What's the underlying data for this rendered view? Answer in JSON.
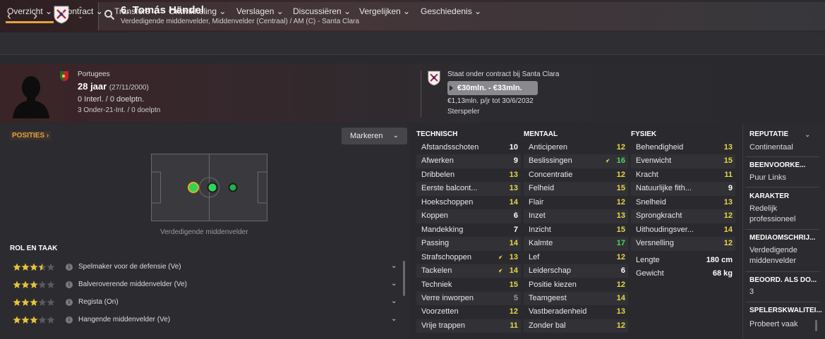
{
  "header": {
    "player_name": "6. Tomás Händel",
    "subtitle": "Verdedigende middenvelder, Middenvelder (Centraal) / AM (C) - Santa Clara"
  },
  "tabs": [
    {
      "label": "Overzicht"
    },
    {
      "label": "Contract"
    },
    {
      "label": "Transfers"
    },
    {
      "label": "Ontwikkeling"
    },
    {
      "label": "Verslagen"
    },
    {
      "label": "Discussiëren"
    },
    {
      "label": "Vergelijken"
    },
    {
      "label": "Geschiedenis"
    }
  ],
  "profile": {
    "nationality": "Portugees",
    "age": "28 jaar",
    "birthdate": "(27/11/2000)",
    "internationals": "0 Interl. / 0 doelptn.",
    "u21": "3 Onder-21-Int. / 0 doelptn",
    "contract": "Staat onder contract bij Santa Clara",
    "value": "€30mln. - €33mln.",
    "wage": "€1,13mln. p/jr tot 30/6/2032",
    "status": "Sterspeler"
  },
  "positions": {
    "title": "POSITIES",
    "highlight_button": "Markeren",
    "pitch_label": "Verdedigende middenvelder"
  },
  "roles": {
    "title": "ROL EN TAAK",
    "items": [
      {
        "label": "Spelmaker voor de defensie (Ve)",
        "stars": 3.5
      },
      {
        "label": "Balveroverende middenvelder (Ve)",
        "stars": 3
      },
      {
        "label": "Regista (On)",
        "stars": 3
      },
      {
        "label": "Hangende middenvelder (Ve)",
        "stars": 3
      }
    ]
  },
  "attributes": {
    "technical_title": "TECHNISCH",
    "mental_title": "MENTAAL",
    "physical_title": "FYSIEK",
    "technical": [
      {
        "name": "Afstandsschoten",
        "value": "10",
        "color": "white"
      },
      {
        "name": "Afwerken",
        "value": "9",
        "color": "white"
      },
      {
        "name": "Dribbelen",
        "value": "13",
        "color": "yellow"
      },
      {
        "name": "Eerste balcont...",
        "value": "13",
        "color": "yellow"
      },
      {
        "name": "Hoekschoppen",
        "value": "14",
        "color": "yellow"
      },
      {
        "name": "Koppen",
        "value": "6",
        "color": "white"
      },
      {
        "name": "Mandekking",
        "value": "7",
        "color": "white"
      },
      {
        "name": "Passing",
        "value": "14",
        "color": "yellow"
      },
      {
        "name": "Strafschoppen",
        "value": "13",
        "color": "yellow",
        "arrow": true
      },
      {
        "name": "Tackelen",
        "value": "14",
        "color": "yellow",
        "arrow": true
      },
      {
        "name": "Techniek",
        "value": "15",
        "color": "yellow"
      },
      {
        "name": "Verre inworpen",
        "value": "5",
        "color": "grey"
      },
      {
        "name": "Voorzetten",
        "value": "12",
        "color": "yellow"
      },
      {
        "name": "Vrije trappen",
        "value": "11",
        "color": "yellow"
      }
    ],
    "mental": [
      {
        "name": "Anticiperen",
        "value": "12",
        "color": "yellow"
      },
      {
        "name": "Beslissingen",
        "value": "16",
        "color": "green",
        "arrow": true
      },
      {
        "name": "Concentratie",
        "value": "12",
        "color": "yellow"
      },
      {
        "name": "Felheid",
        "value": "15",
        "color": "yellow"
      },
      {
        "name": "Flair",
        "value": "12",
        "color": "yellow"
      },
      {
        "name": "Inzet",
        "value": "13",
        "color": "yellow"
      },
      {
        "name": "Inzicht",
        "value": "15",
        "color": "yellow"
      },
      {
        "name": "Kalmte",
        "value": "17",
        "color": "green"
      },
      {
        "name": "Lef",
        "value": "12",
        "color": "yellow"
      },
      {
        "name": "Leiderschap",
        "value": "6",
        "color": "white"
      },
      {
        "name": "Positie kiezen",
        "value": "12",
        "color": "yellow"
      },
      {
        "name": "Teamgeest",
        "value": "14",
        "color": "yellow"
      },
      {
        "name": "Vastberadenheid",
        "value": "13",
        "color": "yellow"
      },
      {
        "name": "Zonder bal",
        "value": "12",
        "color": "yellow"
      }
    ],
    "physical": [
      {
        "name": "Behendigheid",
        "value": "13",
        "color": "yellow"
      },
      {
        "name": "Evenwicht",
        "value": "15",
        "color": "yellow"
      },
      {
        "name": "Kracht",
        "value": "11",
        "color": "yellow"
      },
      {
        "name": "Natuurlijke fith...",
        "value": "9",
        "color": "white"
      },
      {
        "name": "Snelheid",
        "value": "13",
        "color": "yellow"
      },
      {
        "name": "Sprongkracht",
        "value": "12",
        "color": "yellow"
      },
      {
        "name": "Uithoudingsver...",
        "value": "14",
        "color": "yellow"
      },
      {
        "name": "Versnelling",
        "value": "12",
        "color": "yellow"
      }
    ],
    "height_label": "Lengte",
    "height_value": "180 cm",
    "weight_label": "Gewicht",
    "weight_value": "68 kg"
  },
  "sidebar": {
    "sections": [
      {
        "head": "REPUTATIE",
        "value": "Continentaal"
      },
      {
        "head": "BEENVOORKE...",
        "value": "Puur Links"
      },
      {
        "head": "KARAKTER",
        "value": "Redelijk professioneel"
      },
      {
        "head": "MEDIAOMSCHRIJ...",
        "value": "Verdedigende middenvelder"
      },
      {
        "head": "BEOORD. ALS DO...",
        "value": "3"
      },
      {
        "head": "SPELERSKWALITEI...",
        "value": "Probeert vaak"
      }
    ]
  },
  "colors": {
    "accent": "#e8a23a",
    "attr_yellow": "#e8d64a",
    "attr_green": "#4ed36a",
    "attr_white": "#ffffff",
    "attr_grey": "#9a9a9e"
  }
}
